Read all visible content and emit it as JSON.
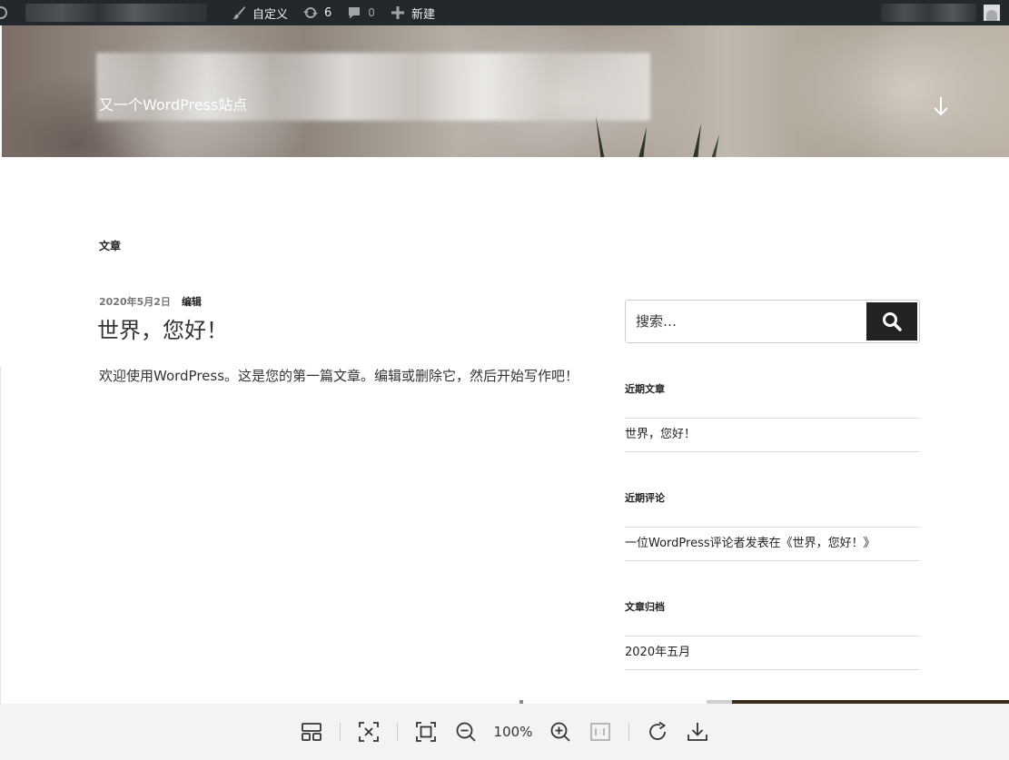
{
  "admin_bar": {
    "customize": "自定义",
    "updates_count": "6",
    "comments_count": "0",
    "new": "新建"
  },
  "header": {
    "tagline": "又一个WordPress站点"
  },
  "main": {
    "archive_title": "文章",
    "post": {
      "date": "2020年5月2日",
      "edit": "编辑",
      "title": "世界，您好！",
      "content": "欢迎使用WordPress。这是您的第一篇文章。编辑或删除它，然后开始写作吧！"
    }
  },
  "sidebar": {
    "search_placeholder": "搜索…",
    "recent_posts_title": "近期文章",
    "recent_posts": [
      "世界，您好！"
    ],
    "recent_comments_title": "近期评论",
    "recent_comments": [
      "一位WordPress评论者发表在《世界，您好！》"
    ],
    "archives_title": "文章归档",
    "archives": [
      "2020年五月"
    ]
  },
  "viewer": {
    "zoom": "100%"
  },
  "colors": {
    "admin_bar_bg": "#23282d",
    "search_button_bg": "#222222"
  }
}
